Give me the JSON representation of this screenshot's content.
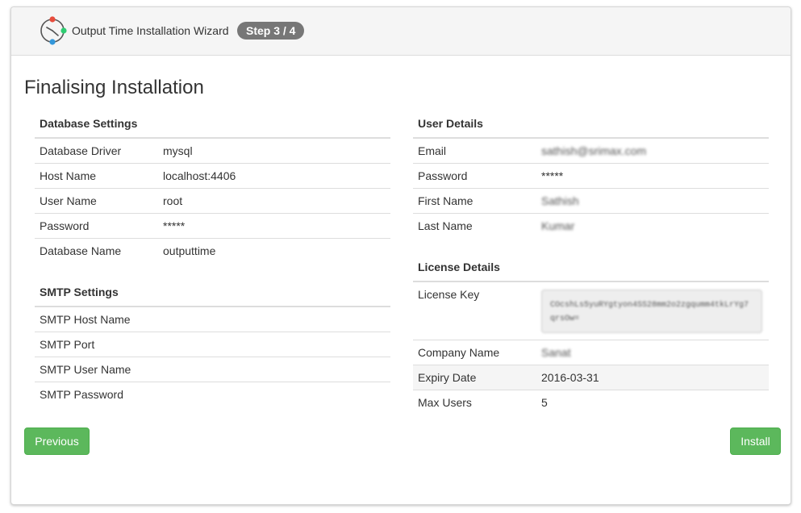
{
  "header": {
    "title": "Output Time Installation Wizard",
    "step": "Step 3 / 4",
    "logo_icon": "clock-logo-icon"
  },
  "page_title": "Finalising Installation",
  "database": {
    "heading": "Database Settings",
    "rows": [
      {
        "label": "Database Driver",
        "value": "mysql"
      },
      {
        "label": "Host Name",
        "value": "localhost:4406"
      },
      {
        "label": "User Name",
        "value": "root"
      },
      {
        "label": "Password",
        "value": "*****"
      },
      {
        "label": "Database Name",
        "value": "outputtime"
      }
    ]
  },
  "smtp": {
    "heading": "SMTP Settings",
    "rows": [
      {
        "label": "SMTP Host Name",
        "value": ""
      },
      {
        "label": "SMTP Port",
        "value": ""
      },
      {
        "label": "SMTP User Name",
        "value": ""
      },
      {
        "label": "SMTP Password",
        "value": ""
      }
    ]
  },
  "user": {
    "heading": "User Details",
    "rows": [
      {
        "label": "Email",
        "value": "sathish@srimax.com"
      },
      {
        "label": "Password",
        "value": "*****"
      },
      {
        "label": "First Name",
        "value": "Sathish"
      },
      {
        "label": "Last Name",
        "value": "Kumar"
      }
    ]
  },
  "license": {
    "heading": "License Details",
    "key_label": "License Key",
    "key_value": "COcshLs5yuRYgtyon4SS28mm2o2zgqumm4tkLrYg7qrsOw=",
    "rows": [
      {
        "label": "Company Name",
        "value": "Sanat"
      },
      {
        "label": "Expiry Date",
        "value": "2016-03-31"
      },
      {
        "label": "Max Users",
        "value": "5"
      }
    ]
  },
  "buttons": {
    "previous": "Previous",
    "install": "Install"
  },
  "colors": {
    "success": "#5cb85c",
    "badge": "#777777",
    "header_bg": "#f5f5f5"
  }
}
